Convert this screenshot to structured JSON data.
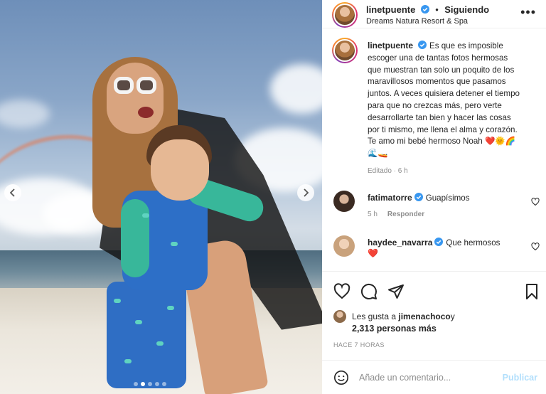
{
  "post": {
    "images_count": 5,
    "active_image_index": 1
  },
  "header": {
    "username": "linetpuente",
    "separator": "•",
    "follow_label": "Siguiendo",
    "location": "Dreams Natura Resort & Spa",
    "more_icon": "more-horizontal-icon"
  },
  "caption": {
    "username": "linetpuente",
    "text": "Es que es imposible escoger una de tantas fotos hermosas que muestran tan solo un poquito de los maravillosos momentos que pasamos juntos. A veces quisiera detener el tiempo para que no crezcas más, pero verte desarrollarte tan bien y hacer las cosas por ti mismo, me llena el alma y corazón. Te amo mi bebé hermoso Noah ❤️🌞🌈🌊🚤",
    "meta": "Editado · 6 h"
  },
  "comments": [
    {
      "username": "fatimatorre",
      "text": "Guapísimos",
      "time": "5 h",
      "reply_label": "Responder"
    },
    {
      "username": "haydee_navarra",
      "text": "Que hermosos",
      "text2": "❤️"
    }
  ],
  "actions": {
    "likes_prefix": "Les gusta a ",
    "likes_user": "jimenachoco",
    "likes_suffix": " y",
    "likes_count": "2,313 personas más",
    "time": "HACE 7 HORAS"
  },
  "comment_box": {
    "placeholder": "Añade un comentario...",
    "publish_label": "Publicar"
  },
  "colors": {
    "verified": "#3897f0",
    "publish_disabled": "#b2dffc",
    "heart": "#ed4956"
  }
}
